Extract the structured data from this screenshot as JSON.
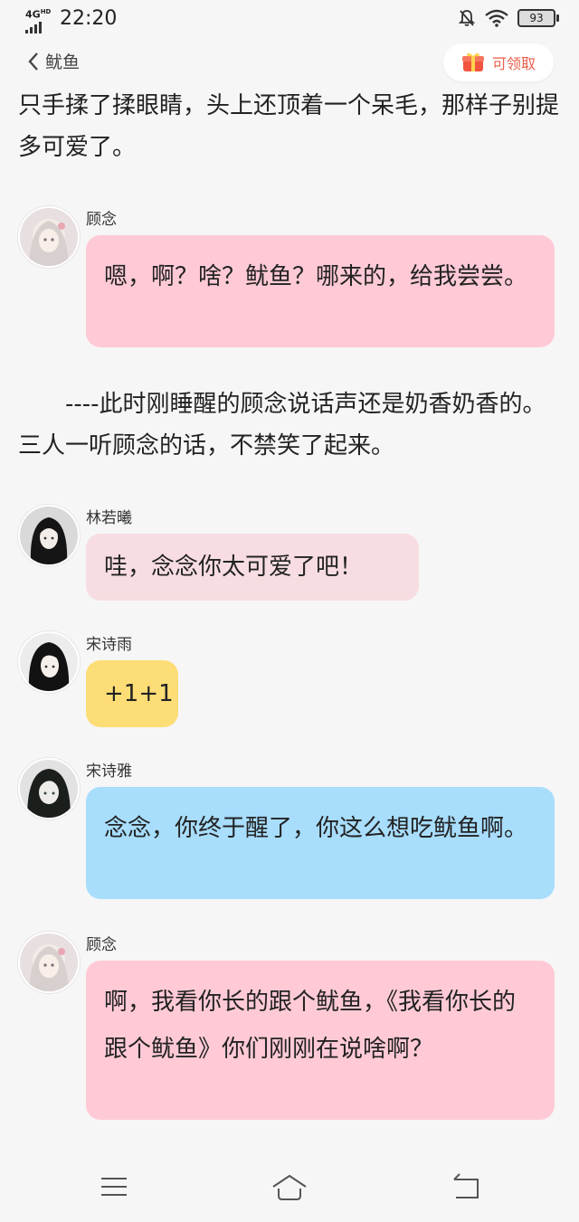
{
  "status": {
    "network": "4G",
    "network_sub": "HD",
    "time": "22:20",
    "battery": "93",
    "icons": [
      "bell-muted-icon",
      "wifi-icon",
      "battery-icon"
    ]
  },
  "nav": {
    "back_label": "鱿鱼",
    "claim_label": "可领取",
    "claim_icon": "gift-icon"
  },
  "story": {
    "intro": "只手揉了揉眼睛，头上还顶着一个呆毛，那样子别提多可爱了。",
    "narration": "　　----此时刚睡醒的顾念说话声还是奶香奶香的。三人一听顾念的话，不禁笑了起来。"
  },
  "messages": [
    {
      "name": "顾念",
      "text": "嗯，啊？啥？鱿鱼？哪来的，给我尝尝。",
      "color": "#ffcad6"
    },
    {
      "name": "林若曦",
      "text": "哇，念念你太可爱了吧！",
      "color": "#f7dde1"
    },
    {
      "name": "宋诗雨",
      "text": "+1+1",
      "color": "#fddd76"
    },
    {
      "name": "宋诗雅",
      "text": "念念，你终于醒了，你这么想吃鱿鱼啊。",
      "color": "#a8ddfc"
    },
    {
      "name": "顾念",
      "text": "啊，我看你长的跟个鱿鱼，《我看你长的跟个鱿鱼》你们刚刚在说啥啊？",
      "color": "#ffcad6"
    }
  ],
  "bottom_nav": [
    "menu-icon",
    "home-icon",
    "back-icon"
  ]
}
